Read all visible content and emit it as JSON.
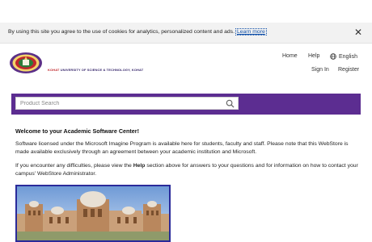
{
  "cookie_bar": {
    "text": "By using this site you agree to the use of cookies for analytics, personalized content and ads.",
    "link_label": "Learn more",
    "close_glyph": "✕"
  },
  "header": {
    "logo_text_red": "KOHAT",
    "logo_text": "UNIVERSITY OF SCIENCE & TECHNOLOGY, KOHAT",
    "nav": {
      "home": "Home",
      "help": "Help",
      "language": "English",
      "sign_in": "Sign In",
      "register": "Register"
    }
  },
  "search": {
    "placeholder": "Product Search",
    "band_color": "#5c2d91"
  },
  "content": {
    "welcome": "Welcome to your Academic Software Center!",
    "para1": "Software licensed under the Microsoft Imagine Program is available here for students, faculty and staff. Please note that this WebStore is made available exclusively through an agreement between your academic institution and Microsoft.",
    "para2_pre": "If you encounter any difficulties, please view the ",
    "para2_bold": "Help",
    "para2_post": " section above for answers to your questions and for information on how to contact your campus' WebStore Administrator."
  },
  "icons": {
    "close": "close-icon",
    "globe": "globe-icon",
    "search": "search-icon"
  }
}
